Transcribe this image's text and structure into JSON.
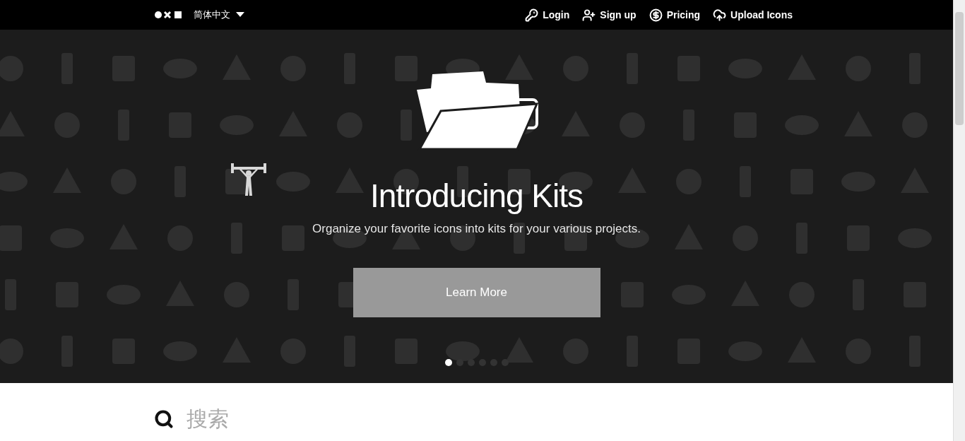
{
  "topbar": {
    "language": "简体中文",
    "links": [
      {
        "kind": "key",
        "label": "Login"
      },
      {
        "kind": "user",
        "label": "Sign up"
      },
      {
        "kind": "dollar",
        "label": "Pricing"
      },
      {
        "kind": "upload",
        "label": "Upload Icons"
      }
    ]
  },
  "hero": {
    "title": "Introducing Kits",
    "subtitle": "Organize your favorite icons into kits for your various projects.",
    "button": "Learn More",
    "slides": [
      {
        "selected": true
      },
      {
        "selected": false
      },
      {
        "selected": false
      },
      {
        "selected": false
      },
      {
        "selected": false
      },
      {
        "selected": false
      }
    ]
  },
  "search": {
    "placeholder": "搜索"
  }
}
